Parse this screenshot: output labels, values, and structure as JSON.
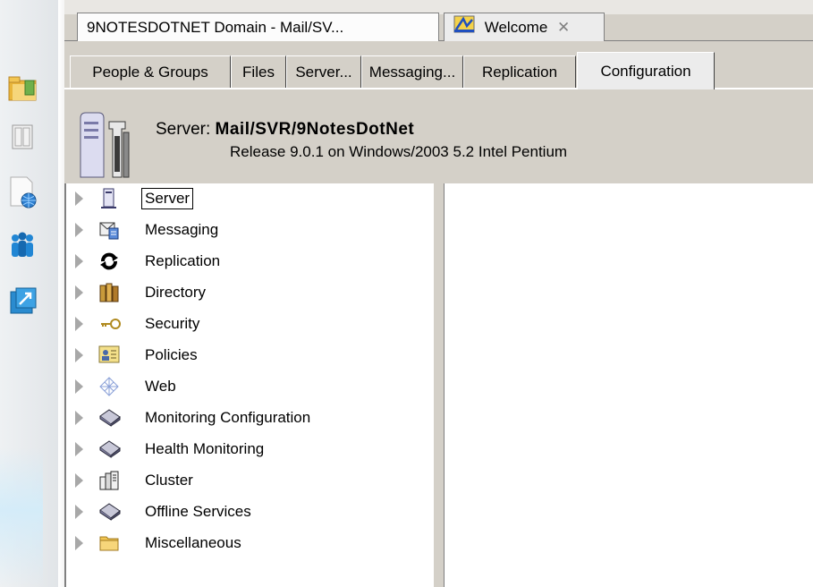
{
  "document_tabs": [
    {
      "label": "9NOTESDOTNET Domain - Mail/SV...",
      "icon": "domain-icon"
    },
    {
      "label": "Welcome",
      "icon": "welcome-icon",
      "close_glyph": "✕"
    }
  ],
  "view_tabs": [
    {
      "label": "People & Groups"
    },
    {
      "label": "Files"
    },
    {
      "label": "Server..."
    },
    {
      "label": "Messaging..."
    },
    {
      "label": "Replication"
    },
    {
      "label": "Configuration",
      "active": true
    }
  ],
  "server_header": {
    "prefix": "Server:",
    "name": "Mail/SVR/9NotesDotNet",
    "release": "Release 9.0.1 on Windows/2003 5.2 Intel Pentium"
  },
  "launcher": {
    "icons": [
      "mail-folder-icon",
      "documents-icon",
      "web-page-icon",
      "people-icon",
      "replicator-icon"
    ]
  },
  "tree": {
    "items": [
      {
        "label": "Server",
        "icon": "server-icon",
        "selected": true
      },
      {
        "label": "Messaging",
        "icon": "messaging-icon"
      },
      {
        "label": "Replication",
        "icon": "replication-icon"
      },
      {
        "label": "Directory",
        "icon": "directory-icon"
      },
      {
        "label": "Security",
        "icon": "key-icon"
      },
      {
        "label": "Policies",
        "icon": "policies-icon"
      },
      {
        "label": "Web",
        "icon": "web-icon"
      },
      {
        "label": "Monitoring Configuration",
        "icon": "book-icon"
      },
      {
        "label": "Health Monitoring",
        "icon": "book-icon"
      },
      {
        "label": "Cluster",
        "icon": "cluster-icon"
      },
      {
        "label": "Offline Services",
        "icon": "book-icon"
      },
      {
        "label": "Miscellaneous",
        "icon": "folder-icon"
      }
    ]
  },
  "colors": {
    "chrome": "#d4d0c8",
    "accent_blue": "#1d7ec2",
    "folder_yellow": "#f2c552"
  }
}
